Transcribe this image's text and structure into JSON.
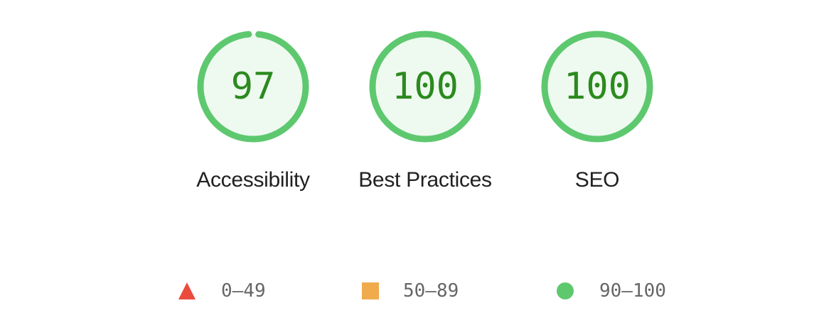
{
  "gauges": [
    {
      "label": "Accessibility",
      "score": "97",
      "fraction": 0.97
    },
    {
      "label": "Best Practices",
      "score": "100",
      "fraction": 1.0
    },
    {
      "label": "SEO",
      "score": "100",
      "fraction": 1.0
    }
  ],
  "legend": [
    {
      "shape": "triangle",
      "range": "0–49",
      "color": "#eb4b3c"
    },
    {
      "shape": "square",
      "range": "50–89",
      "color": "#f0ab4c"
    },
    {
      "shape": "circle",
      "range": "90–100",
      "color": "#5ec86f"
    }
  ],
  "colors": {
    "pass_ring": "#5ec86f",
    "pass_fill": "#eefaf0",
    "pass_text": "#2c8a1e"
  }
}
